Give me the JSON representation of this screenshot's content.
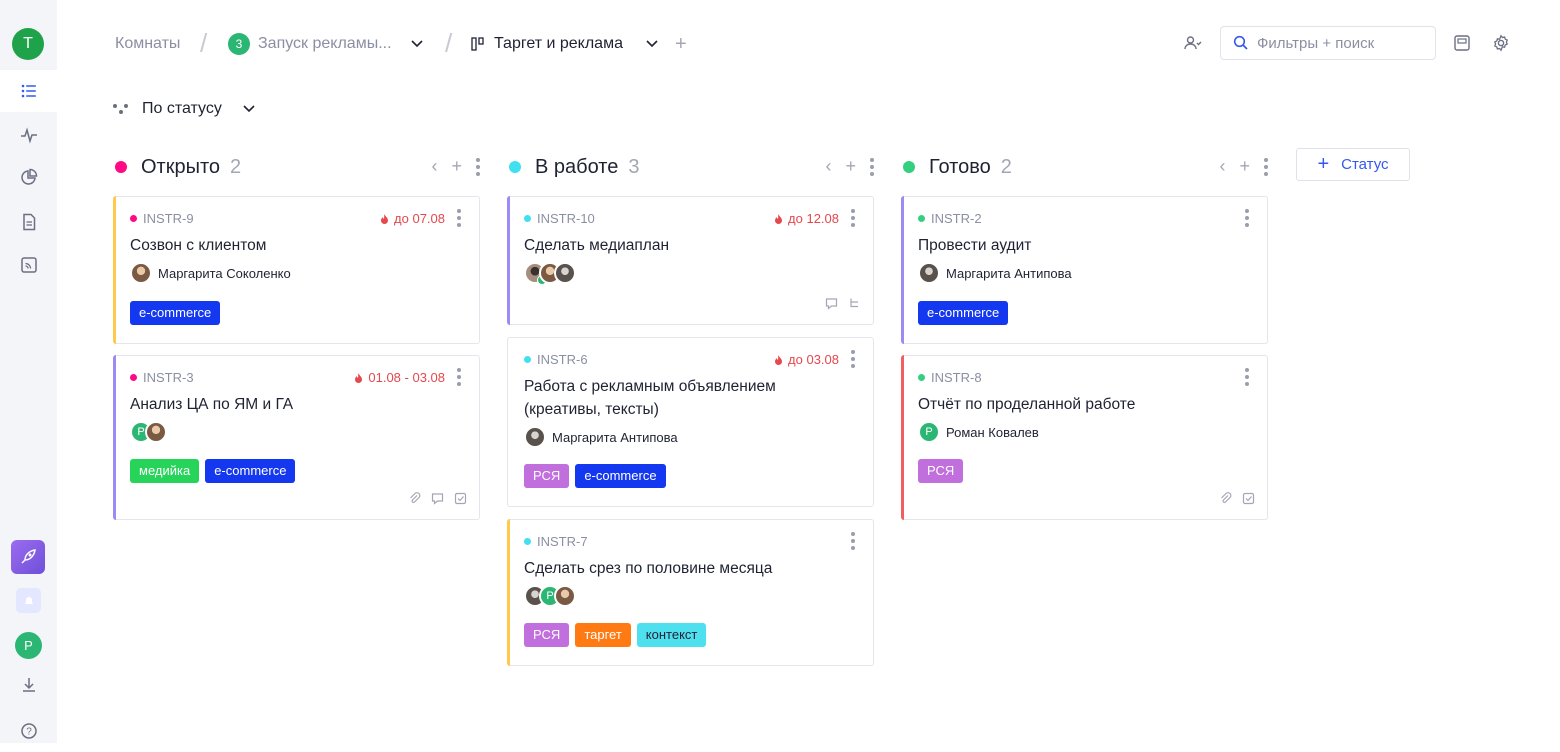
{
  "workspace": {
    "avatar_letter": "T",
    "user_letter": "P"
  },
  "breadcrumb": {
    "rooms": "Комнаты",
    "room_badge": "3",
    "room": "Запуск рекламы...",
    "board": "Таргет и реклама"
  },
  "search": {
    "placeholder": "Фильтры + поиск"
  },
  "group_by": {
    "label": "По статусу"
  },
  "add_status": {
    "label": "Статус"
  },
  "colors": {
    "open": "#ff0a84",
    "in_progress": "#3fe0f0",
    "done": "#35d07f",
    "ecommerce": "#1437f0",
    "rsa": "#c06fdc"
  },
  "columns": [
    {
      "name": "Открыто",
      "count": "2",
      "cards": [
        {
          "id": "INSTR-9",
          "due": "до 07.08",
          "title": "Созвон с клиентом",
          "assignee": "Маргарита Соколенко",
          "tags": [
            "e-commerce"
          ]
        },
        {
          "id": "INSTR-3",
          "due": "01.08 - 03.08",
          "title": "Анализ ЦА по ЯМ и ГА",
          "avatar_letter": "Р",
          "tags": [
            "медийка",
            "e-commerce"
          ]
        }
      ]
    },
    {
      "name": "В работе",
      "count": "3",
      "cards": [
        {
          "id": "INSTR-10",
          "due": "до 12.08",
          "title": "Сделать медиаплан"
        },
        {
          "id": "INSTR-6",
          "due": "до 03.08",
          "title": "Работа с рекламным объявлением (креативы, тексты)",
          "assignee": "Маргарита Антипова",
          "tags": [
            "РСЯ",
            "e-commerce"
          ]
        },
        {
          "id": "INSTR-7",
          "title": "Сделать срез по половине месяца",
          "avatar_letter": "Р",
          "tags": [
            "РСЯ",
            "таргет",
            "контекст"
          ]
        }
      ]
    },
    {
      "name": "Готово",
      "count": "2",
      "cards": [
        {
          "id": "INSTR-2",
          "title": "Провести аудит",
          "assignee": "Маргарита Антипова",
          "tags": [
            "e-commerce"
          ]
        },
        {
          "id": "INSTR-8",
          "title": "Отчёт по проделанной работе",
          "avatar_letter": "Р",
          "assignee": "Роман Ковалев",
          "tags": [
            "РСЯ"
          ]
        }
      ]
    }
  ]
}
